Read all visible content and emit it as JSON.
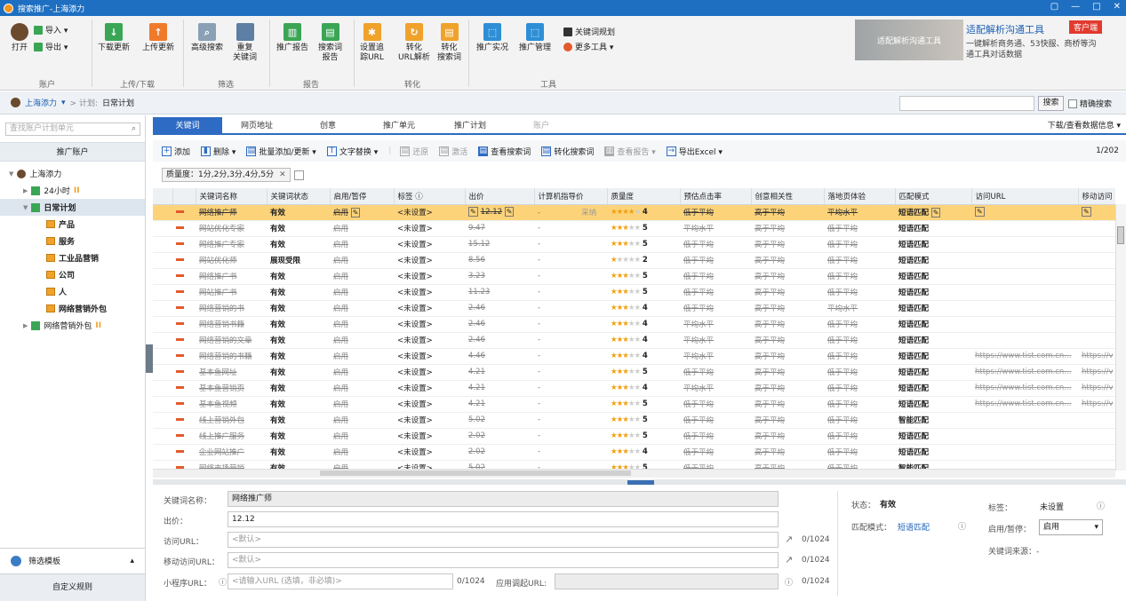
{
  "window": {
    "title": "搜索推广-上海添力",
    "controls": [
      "▢",
      "—",
      "□",
      "✕"
    ]
  },
  "ribbon": {
    "account": {
      "open": "打开",
      "import": "导入 ▾",
      "export": "导出 ▾",
      "group": "账户"
    },
    "updown": {
      "download": "下载更新",
      "upload": "上传更新",
      "group": "上传/下载"
    },
    "filter": {
      "adv_search": "高级搜索",
      "dup": "重复\n关键词",
      "group": "筛选"
    },
    "report": {
      "promo": "推广报告",
      "search_term": "搜索词\n报告",
      "group": "报告"
    },
    "convert": {
      "track": "设置追\n踪URL",
      "parse": "转化\nURL解析",
      "term": "转化\n搜索词",
      "group": "转化"
    },
    "tools": {
      "live": "推广实况",
      "manage": "推广管理",
      "kw_tool": "关键词规划",
      "more": "更多工具 ▾",
      "group": "工具"
    },
    "ad": {
      "image_text": "适配解析沟通工具",
      "title": "适配解析沟通工具",
      "badge": "客户端",
      "desc": "一键解析商务通、53快服、商桥等沟通工具对话数据"
    }
  },
  "crumb": {
    "account": "上海添力",
    "plan_label": "> 计划:",
    "plan": "日常计划",
    "search_btn": "搜索",
    "exact": "精确搜索"
  },
  "left": {
    "search_placeholder": "查找账户计划单元",
    "header": "推广账户",
    "tree": [
      {
        "label": "上海添力",
        "level": 0,
        "type": "user"
      },
      {
        "label": "24小时",
        "level": 1,
        "type": "plan",
        "mark": "II"
      },
      {
        "label": "日常计划",
        "level": 1,
        "type": "plan",
        "bold": true
      },
      {
        "label": "产品",
        "level": 2,
        "type": "unit",
        "bold": true
      },
      {
        "label": "服务",
        "level": 2,
        "type": "unit",
        "bold": true
      },
      {
        "label": "工业品营销",
        "level": 2,
        "type": "unit",
        "bold": true
      },
      {
        "label": "公司",
        "level": 2,
        "type": "unit",
        "bold": true
      },
      {
        "label": "人",
        "level": 2,
        "type": "unit",
        "bold": true
      },
      {
        "label": "网络营销外包",
        "level": 2,
        "type": "unit",
        "bold": true
      },
      {
        "label": "网络营销外包",
        "level": 1,
        "type": "plan",
        "mark": "II"
      }
    ],
    "filter_template": "筛选模板",
    "custom_rule": "自定义规则"
  },
  "tabs": [
    {
      "label": "关键词",
      "active": true
    },
    {
      "label": "网页地址"
    },
    {
      "label": "创意"
    },
    {
      "label": "推广单元"
    },
    {
      "label": "推广计划"
    },
    {
      "label": "账户",
      "disabled": true
    }
  ],
  "download_info": "下载/查看数据信息 ▾",
  "toolbar": {
    "add": "添加",
    "delete": "删除 ▾",
    "batch": "批量添加/更新 ▾",
    "replace": "文字替换 ▾",
    "restore": "还原",
    "activate": "激活",
    "view_terms": "查看搜索词",
    "convert_terms": "转化搜索词",
    "view_report": "查看报告 ▾",
    "export": "导出Excel ▾",
    "pager": "1/202"
  },
  "filter_chip": {
    "text": "质量度：1分,2分,3分,4分,5分",
    "close": "✕"
  },
  "grid": {
    "headers": [
      "关键词名称",
      "关键词状态",
      "启用/暂停",
      "标签 ⓘ",
      "出价",
      "计算机指导价",
      "质量度",
      "预估点击率",
      "创意相关性",
      "落地页体验",
      "匹配模式",
      "访问URL",
      "移动访问"
    ],
    "rows": [
      {
        "kw": "网络推广师",
        "status": "有效",
        "enable": "启用",
        "tag": "<未设置>",
        "bid": "12.12",
        "guide": "-",
        "guide2": "采纳",
        "stars": 4,
        "q": "4",
        "ctr": "低于平均",
        "rel": "高于平均",
        "lp": "平均水平",
        "match": "短语匹配",
        "url": "",
        "murl": "",
        "sel": true
      },
      {
        "kw": "网站优化专家",
        "status": "有效",
        "enable": "启用",
        "tag": "<未设置>",
        "bid": "9.47",
        "guide": "-",
        "stars": 3,
        "q": "5",
        "ctr": "平均水平",
        "rel": "高于平均",
        "lp": "低于平均",
        "match": "短语匹配",
        "url": "",
        "murl": ""
      },
      {
        "kw": "网络推广专家",
        "status": "有效",
        "enable": "启用",
        "tag": "<未设置>",
        "bid": "15.12",
        "guide": "-",
        "stars": 3,
        "q": "5",
        "ctr": "低于平均",
        "rel": "高于平均",
        "lp": "低于平均",
        "match": "短语匹配",
        "url": "",
        "murl": ""
      },
      {
        "kw": "网站优化师",
        "status": "展现受限",
        "enable": "启用",
        "tag": "<未设置>",
        "bid": "8.56",
        "guide": "-",
        "stars": 1,
        "q": "2",
        "ctr": "低于平均",
        "rel": "高于平均",
        "lp": "低于平均",
        "match": "短语匹配",
        "url": "",
        "murl": ""
      },
      {
        "kw": "网络推广书",
        "status": "有效",
        "enable": "启用",
        "tag": "<未设置>",
        "bid": "3.23",
        "guide": "-",
        "stars": 3,
        "q": "5",
        "ctr": "低于平均",
        "rel": "高于平均",
        "lp": "低于平均",
        "match": "短语匹配",
        "url": "",
        "murl": ""
      },
      {
        "kw": "网站推广书",
        "status": "有效",
        "enable": "启用",
        "tag": "<未设置>",
        "bid": "11.23",
        "guide": "-",
        "stars": 3,
        "q": "5",
        "ctr": "低于平均",
        "rel": "高于平均",
        "lp": "低于平均",
        "match": "短语匹配",
        "url": "",
        "murl": ""
      },
      {
        "kw": "网络营销的书",
        "status": "有效",
        "enable": "启用",
        "tag": "<未设置>",
        "bid": "2.46",
        "guide": "-",
        "stars": 3,
        "q": "4",
        "ctr": "低于平均",
        "rel": "高于平均",
        "lp": "平均水平",
        "match": "短语匹配",
        "url": "",
        "murl": ""
      },
      {
        "kw": "网络营销书籍",
        "status": "有效",
        "enable": "启用",
        "tag": "<未设置>",
        "bid": "2.46",
        "guide": "-",
        "stars": 3,
        "q": "4",
        "ctr": "平均水平",
        "rel": "高于平均",
        "lp": "低于平均",
        "match": "短语匹配",
        "url": "",
        "murl": ""
      },
      {
        "kw": "网络营销的文章",
        "status": "有效",
        "enable": "启用",
        "tag": "<未设置>",
        "bid": "2.46",
        "guide": "-",
        "stars": 3,
        "q": "4",
        "ctr": "平均水平",
        "rel": "高于平均",
        "lp": "低于平均",
        "match": "短语匹配",
        "url": "",
        "murl": ""
      },
      {
        "kw": "网络营销的书籍",
        "status": "有效",
        "enable": "启用",
        "tag": "<未设置>",
        "bid": "4.46",
        "guide": "-",
        "stars": 3,
        "q": "4",
        "ctr": "平均水平",
        "rel": "高于平均",
        "lp": "低于平均",
        "match": "短语匹配",
        "url": "https://www.tist.com.cn...",
        "murl": "https://v"
      },
      {
        "kw": "基本鱼网址",
        "status": "有效",
        "enable": "启用",
        "tag": "<未设置>",
        "bid": "4.21",
        "guide": "-",
        "stars": 3,
        "q": "5",
        "ctr": "低于平均",
        "rel": "高于平均",
        "lp": "低于平均",
        "match": "短语匹配",
        "url": "https://www.tist.com.cn...",
        "murl": "https://v"
      },
      {
        "kw": "基本鱼营销页",
        "status": "有效",
        "enable": "启用",
        "tag": "<未设置>",
        "bid": "4.21",
        "guide": "-",
        "stars": 3,
        "q": "4",
        "ctr": "平均水平",
        "rel": "高于平均",
        "lp": "低于平均",
        "match": "短语匹配",
        "url": "https://www.tist.com.cn...",
        "murl": "https://v"
      },
      {
        "kw": "基本鱼视频",
        "status": "有效",
        "enable": "启用",
        "tag": "<未设置>",
        "bid": "4.21",
        "guide": "-",
        "stars": 3,
        "q": "5",
        "ctr": "低于平均",
        "rel": "高于平均",
        "lp": "低于平均",
        "match": "短语匹配",
        "url": "https://www.tist.com.cn...",
        "murl": "https://v"
      },
      {
        "kw": "线上营销外包",
        "status": "有效",
        "enable": "启用",
        "tag": "<未设置>",
        "bid": "5.02",
        "guide": "-",
        "stars": 3,
        "q": "5",
        "ctr": "低于平均",
        "rel": "高于平均",
        "lp": "低于平均",
        "match": "智能匹配",
        "url": "",
        "murl": ""
      },
      {
        "kw": "线上推广服务",
        "status": "有效",
        "enable": "启用",
        "tag": "<未设置>",
        "bid": "2.02",
        "guide": "-",
        "stars": 3,
        "q": "5",
        "ctr": "低于平均",
        "rel": "高于平均",
        "lp": "低于平均",
        "match": "短语匹配",
        "url": "",
        "murl": ""
      },
      {
        "kw": "企业网站推广",
        "status": "有效",
        "enable": "启用",
        "tag": "<未设置>",
        "bid": "2.02",
        "guide": "-",
        "stars": 3,
        "q": "4",
        "ctr": "低于平均",
        "rel": "高于平均",
        "lp": "低于平均",
        "match": "短语匹配",
        "url": "",
        "murl": ""
      },
      {
        "kw": "网络市场营销",
        "status": "有效",
        "enable": "启用",
        "tag": "<未设置>",
        "bid": "5.02",
        "guide": "-",
        "stars": 3,
        "q": "5",
        "ctr": "低于平均",
        "rel": "高于平均",
        "lp": "低于平均",
        "match": "智能匹配",
        "url": "",
        "murl": ""
      }
    ]
  },
  "detail": {
    "kw_label": "关键词名称：",
    "kw_value": "网络推广师",
    "bid_label": "出价：",
    "bid_value": "12.12",
    "url_label": "访问URL：",
    "url_placeholder": "<默认>",
    "url_count": "0/1024",
    "murl_label": "移动访问URL：",
    "murl_placeholder": "<默认>",
    "murl_count": "0/1024",
    "mini_label": "小程序URL：",
    "mini_placeholder": "<请输入URL (选填，非必填)>",
    "mini_count": "0/1024",
    "app_label": "应用调起URL:",
    "app_count": "0/1024",
    "state_label": "状态：",
    "state_value": "有效",
    "match_label": "匹配模式：",
    "match_value": "短语匹配",
    "tag_label": "标签：",
    "tag_value": "未设置",
    "enable_label": "启用/暂停：",
    "enable_value": "启用",
    "source_label": "关键词来源：-"
  }
}
